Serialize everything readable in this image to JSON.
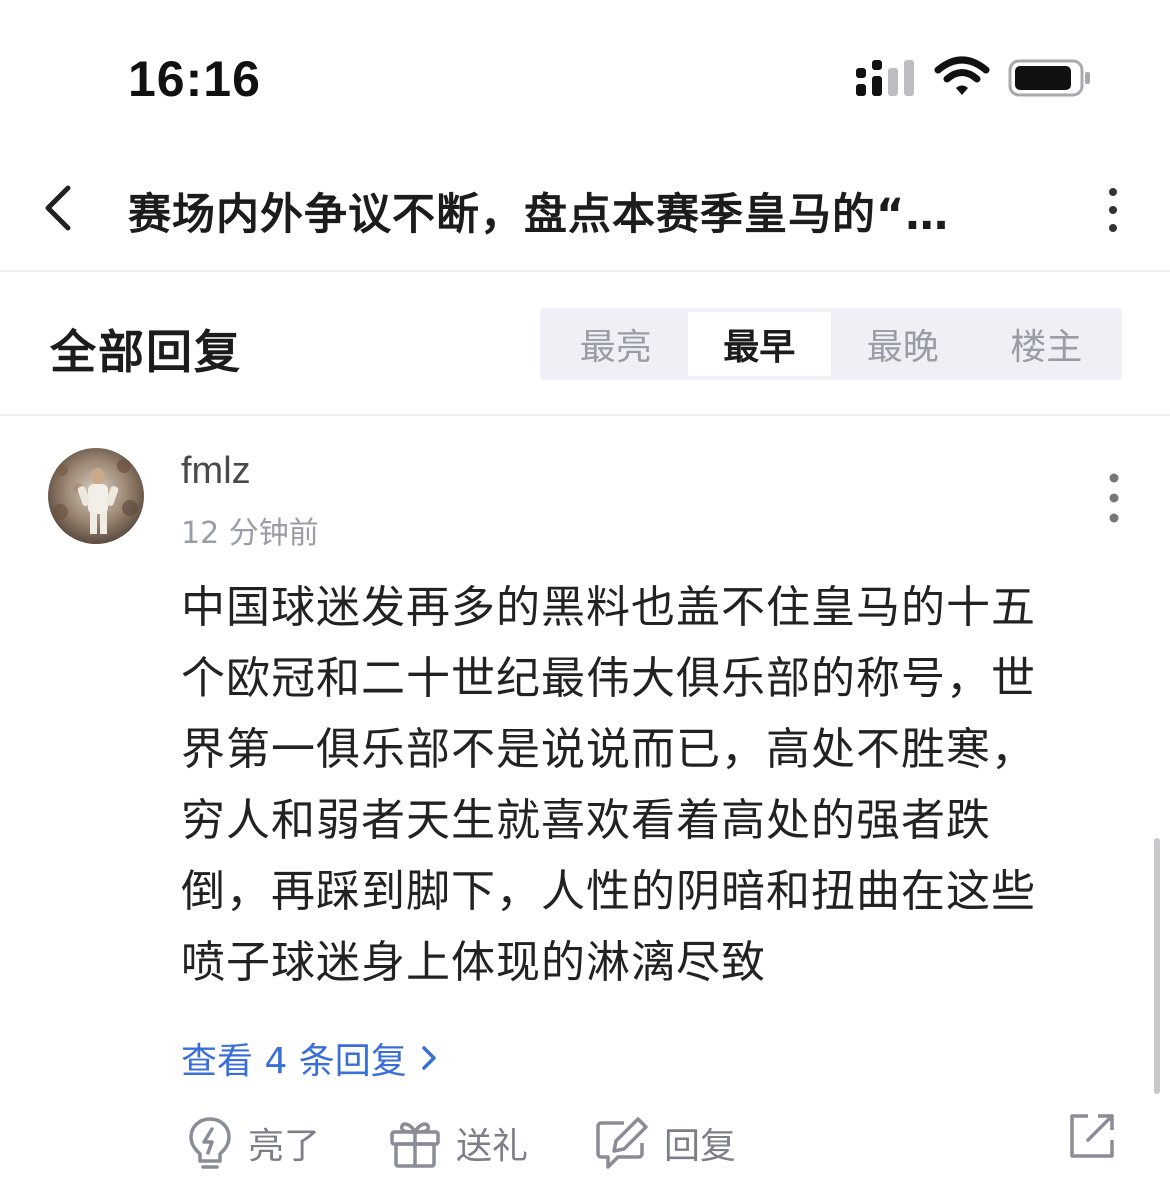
{
  "status_bar": {
    "time": "16:16"
  },
  "nav": {
    "title": "赛场内外争议不断，盘点本赛季皇马的“…",
    "back_icon": "chevron-left-icon",
    "more_icon": "vertical-ellipsis-icon"
  },
  "replies": {
    "title": "全部回复",
    "sort_tabs": [
      {
        "label": "最亮",
        "active": false
      },
      {
        "label": "最早",
        "active": true
      },
      {
        "label": "最晚",
        "active": false
      },
      {
        "label": "楼主",
        "active": false
      }
    ]
  },
  "comment": {
    "username": "fmlz",
    "time": "12 分钟前",
    "body_lines": [
      "中国球迷发再多的黑料也盖不住皇马的十五",
      "个欧冠和二十世纪最伟大俱乐部的称号，世",
      "界第一俱乐部不是说说而已，高处不胜寒，",
      "穷人和弱者天生就喜欢看着高处的强者跌",
      "倒，再踩到脚下，人性的阴暗和扭曲在这些",
      "喷子球迷身上体现的淋漓尽致"
    ],
    "view_replies": "查看 4 条回复",
    "actions": {
      "like": "亮了",
      "gift": "送礼",
      "reply": "回复"
    }
  },
  "colors": {
    "link_blue": "#3a6fd8",
    "tab_bg": "#eef0f6",
    "muted_text": "#9a9ca6"
  }
}
